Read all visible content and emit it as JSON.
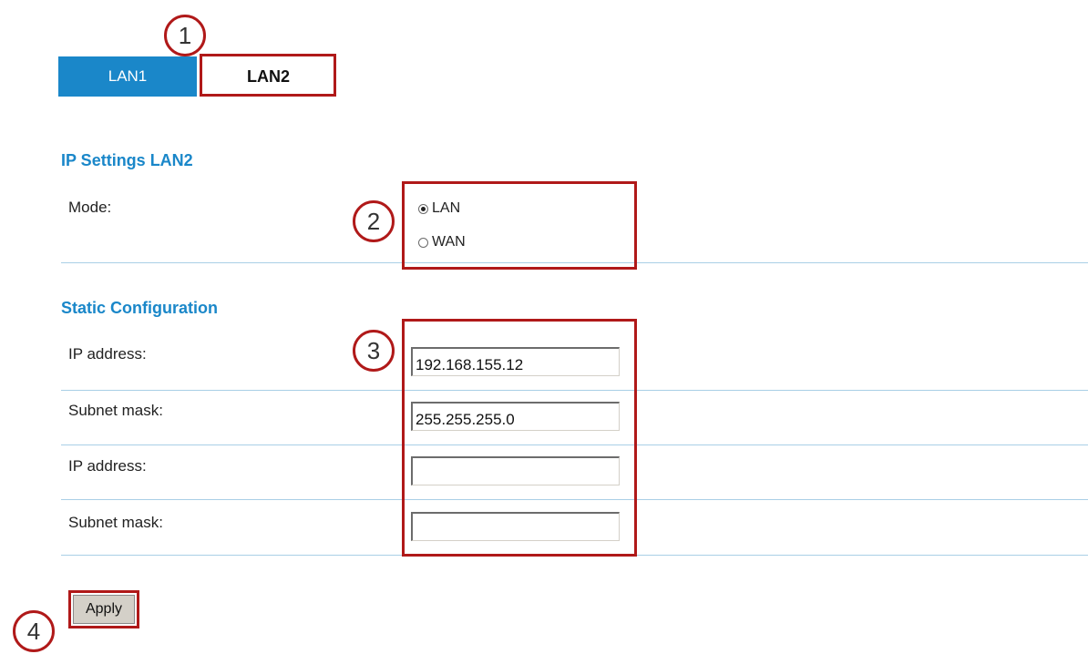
{
  "tabs": [
    {
      "label": "LAN1",
      "active": false
    },
    {
      "label": "LAN2",
      "active": true
    }
  ],
  "callouts": [
    "1",
    "2",
    "3",
    "4"
  ],
  "ip_settings": {
    "heading": "IP Settings LAN2",
    "mode_label": "Mode:",
    "mode_options": [
      {
        "label": "LAN",
        "selected": true
      },
      {
        "label": "WAN",
        "selected": false
      }
    ]
  },
  "static_config": {
    "heading": "Static Configuration",
    "rows": [
      {
        "label": "IP address:",
        "value": ""
      },
      {
        "label": "Subnet mask:",
        "value": ""
      },
      {
        "label": "IP address:",
        "value": ""
      },
      {
        "label": "Subnet mask:",
        "value": ""
      }
    ],
    "values": [
      "192.168.155.12",
      "255.255.255.0",
      "",
      ""
    ]
  },
  "apply_label": "Apply",
  "colors": {
    "accent": "#1a87c9",
    "annotation": "#b01919"
  }
}
